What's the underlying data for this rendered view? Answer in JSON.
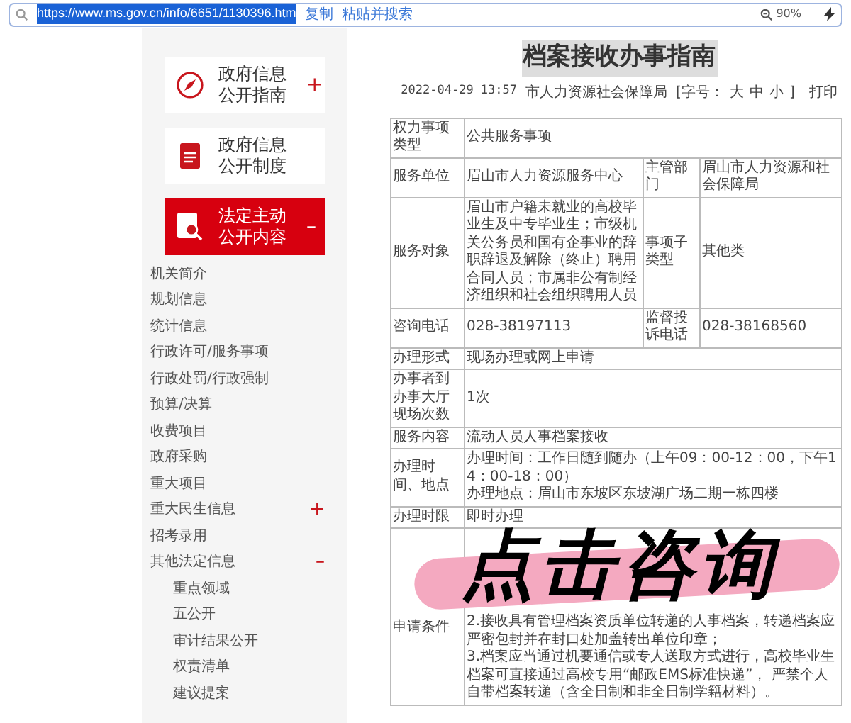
{
  "address_bar": {
    "url": "https://www.ms.gov.cn/info/6651/1130396.htm",
    "actions": [
      "复制",
      "粘贴并搜索"
    ],
    "zoom": "90%"
  },
  "sidebar": {
    "cards": [
      {
        "kind": "compass",
        "label": "政府信息公开指南",
        "toggle": "+",
        "selected": false
      },
      {
        "kind": "book",
        "label": "政府信息公开制度",
        "selected": false
      },
      {
        "kind": "search",
        "label": "法定主动公开内容",
        "toggle": "–",
        "selected": true
      }
    ],
    "items": [
      {
        "label": "机关简介"
      },
      {
        "label": "规划信息"
      },
      {
        "label": "统计信息"
      },
      {
        "label": "行政许可/服务事项"
      },
      {
        "label": "行政处罚/行政强制"
      },
      {
        "label": "预算/决算"
      },
      {
        "label": "收费项目"
      },
      {
        "label": "政府采购"
      },
      {
        "label": "重大项目"
      },
      {
        "label": "重大民生信息",
        "toggle": "+"
      },
      {
        "label": "招考录用"
      },
      {
        "label": "其他法定信息",
        "toggle": "–",
        "children": [
          {
            "label": "重点领域"
          },
          {
            "label": "五公开"
          },
          {
            "label": "审计结果公开"
          },
          {
            "label": "权责清单"
          },
          {
            "label": "建议提案"
          }
        ]
      }
    ]
  },
  "article": {
    "title": "档案接收办事指南",
    "date": "2022-04-29 13:57",
    "source": "市人力资源社会保障局",
    "font_size_label": "[字号：",
    "font_sizes": [
      "大",
      "中",
      "小"
    ],
    "font_size_end": "]",
    "print": "打印",
    "table": {
      "rows": [
        {
          "cells": [
            {
              "text": "权力事项类型"
            },
            {
              "text": "公共服务事项",
              "colspan": 3
            }
          ]
        },
        {
          "cells": [
            {
              "text": "服务单位"
            },
            {
              "text": "眉山市人力资源服务中心"
            },
            {
              "text": "主管部门"
            },
            {
              "text": "眉山市人力资源和社会保障局"
            }
          ]
        },
        {
          "cells": [
            {
              "text": "服务对象"
            },
            {
              "text": "眉山市户籍未就业的高校毕业生及中专毕业生；市级机关公务员和国有企事业的辞职辞退及解除（终止）聘用合同人员；市属非公有制经济组织和社会组织聘用人员"
            },
            {
              "text": "事项子类型"
            },
            {
              "text": "其他类"
            }
          ]
        },
        {
          "cells": [
            {
              "text": "咨询电话"
            },
            {
              "text": "028-38197113"
            },
            {
              "text": "监督投诉电话"
            },
            {
              "text": "028-38168560"
            }
          ]
        },
        {
          "cells": [
            {
              "text": "办理形式"
            },
            {
              "text": "现场办理或网上申请",
              "colspan": 3
            }
          ]
        },
        {
          "cells": [
            {
              "text": "办事者到办事大厅现场次数"
            },
            {
              "text": "1次",
              "colspan": 3
            }
          ]
        },
        {
          "cells": [
            {
              "text": "服务内容"
            },
            {
              "text": "流动人员人事档案接收",
              "colspan": 3
            }
          ]
        },
        {
          "cells": [
            {
              "text": "办理时间、地点"
            },
            {
              "lines": [
                "办理时间：工作日随到随办（上午09：00-12：00，下午14：00-18：00）",
                "办理地点：眉山市东坡区东坡湖广场二期一栋四楼"
              ],
              "colspan": 3
            }
          ]
        },
        {
          "cells": [
            {
              "text": "办理时限"
            },
            {
              "text": "即时办理",
              "colspan": 3
            }
          ]
        },
        {
          "cells": [
            {
              "text": "申请条件"
            },
            {
              "lines": [
                "2.接收具有管理档案资质单位转递的人事档案，转递档案应严密包封并在封口处加盖转出单位印章；",
                "3.档案应当通过机要通信或专人送取方式进行，高校毕业生档案可直接通过高校专用“邮政EMS标准快递”， 严禁个人自带档案转递（含全日制和非全日制学籍材料）。"
              ],
              "colspan": 3
            }
          ]
        }
      ]
    }
  },
  "overlay": {
    "text": "点击咨询"
  }
}
